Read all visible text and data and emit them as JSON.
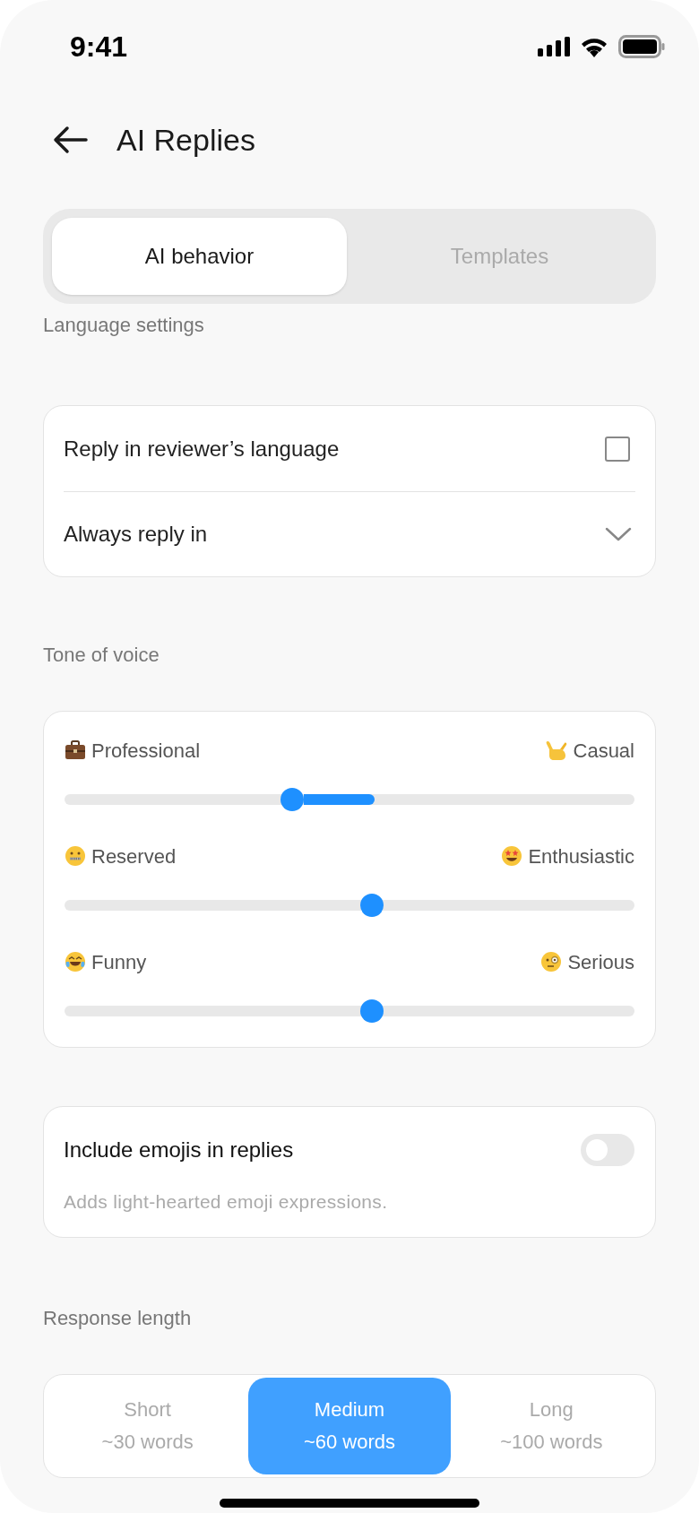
{
  "status_bar": {
    "time": "9:41"
  },
  "header": {
    "title": "AI Replies"
  },
  "tabs": [
    {
      "label": "AI behavior",
      "selected": true
    },
    {
      "label": "Templates",
      "selected": false
    }
  ],
  "language_settings": {
    "heading": "Language settings",
    "rows": [
      {
        "kind": "checkbox",
        "label": "Reply in reviewer’s language",
        "checked": false
      },
      {
        "kind": "dropdown",
        "label": "Always reply in"
      }
    ]
  },
  "tone_of_voice": {
    "heading": "Tone of voice",
    "sliders": [
      {
        "kind": "dragging",
        "left": "Professional",
        "right": "Casual",
        "level": 0.4
      },
      {
        "kind": "idle",
        "left": "Reserved",
        "right": "Enthusiastic",
        "level": 0.54
      },
      {
        "kind": "idle",
        "left": "Funny",
        "right": "Serious",
        "level": 0.54
      }
    ]
  },
  "emojis": {
    "title": "Include emojis in replies",
    "description": "Adds light-hearted emoji expressions.",
    "on": false
  },
  "response_length": {
    "heading": "Response length",
    "options": [
      {
        "label": "Short",
        "detail": "~30 words",
        "selected": false
      },
      {
        "label": "Medium",
        "detail": "~60 words",
        "selected": true
      },
      {
        "label": "Long",
        "detail": "~100 words",
        "selected": false
      }
    ]
  }
}
